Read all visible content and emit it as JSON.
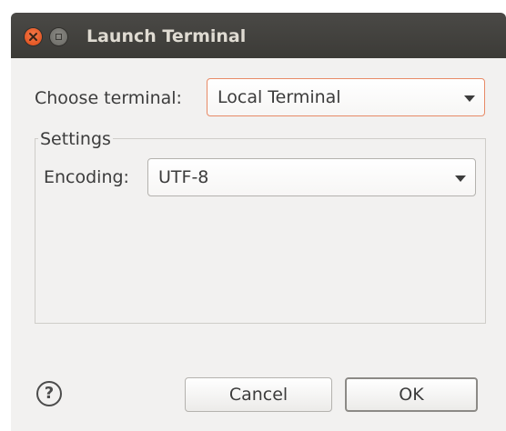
{
  "window": {
    "title": "Launch Terminal"
  },
  "form": {
    "choose_terminal_label": "Choose terminal:",
    "choose_terminal_value": "Local Terminal",
    "settings_group_label": "Settings",
    "encoding_label": "Encoding:",
    "encoding_value": "UTF-8"
  },
  "footer": {
    "help_symbol": "?",
    "cancel_label": "Cancel",
    "ok_label": "OK"
  },
  "icons": {
    "close": "close-icon",
    "minimize": "minimize-icon",
    "dropdown": "chevron-down-icon",
    "help": "help-icon"
  },
  "colors": {
    "titlebar": "#3c3b37",
    "close_button": "#df4a16",
    "focus_border": "#e88a66",
    "dialog_background": "#f2f1f0"
  }
}
